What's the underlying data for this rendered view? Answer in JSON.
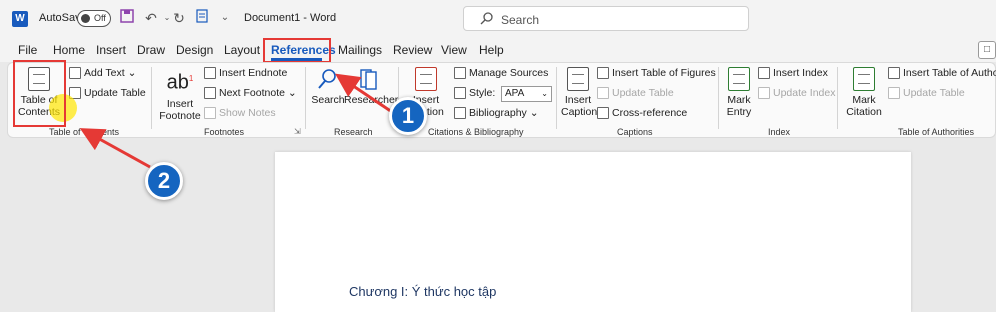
{
  "titlebar": {
    "logo": "W",
    "autosave_label": "AutoSave",
    "autosave_state": "Off",
    "doc_title": "Document1  -  Word",
    "search_placeholder": "Search"
  },
  "tabs": [
    "File",
    "Home",
    "Insert",
    "Draw",
    "Design",
    "Layout",
    "References",
    "Mailings",
    "Review",
    "View",
    "Help"
  ],
  "active_tab": "References",
  "ribbon": {
    "toc": {
      "big_button": [
        "Table of",
        "Contents"
      ],
      "add_text": "Add Text",
      "update_table": "Update Table",
      "group": "Table of Contents"
    },
    "footnotes": {
      "insert_footnote": [
        "Insert",
        "Footnote"
      ],
      "insert_endnote": "Insert Endnote",
      "next_footnote": "Next Footnote",
      "show_notes": "Show Notes",
      "group": "Footnotes"
    },
    "research": {
      "search": "Search",
      "researcher": "Researcher",
      "group": "Research"
    },
    "citations": {
      "insert_citation": [
        "Insert",
        "Citation"
      ],
      "manage_sources": "Manage Sources",
      "style_label": "Style:",
      "style_value": "APA",
      "bibliography": "Bibliography",
      "group": "Citations & Bibliography"
    },
    "captions": {
      "insert_caption": [
        "Insert",
        "Caption"
      ],
      "insert_tof": "Insert Table of Figures",
      "update_table": "Update Table",
      "cross_reference": "Cross-reference",
      "group": "Captions"
    },
    "index": {
      "mark_entry": [
        "Mark",
        "Entry"
      ],
      "insert_index": "Insert Index",
      "update_index": "Update Index",
      "group": "Index"
    },
    "authorities": {
      "mark_citation": [
        "Mark",
        "Citation"
      ],
      "insert_toa": "Insert Table of Authoriti",
      "update_table": "Update Table",
      "group": "Table of Authorities"
    }
  },
  "document": {
    "heading": "Chương I: Ý thức học tập"
  },
  "annotations": {
    "badge1": "1",
    "badge2": "2",
    "color": "#e53935",
    "badge_color": "#1565c0"
  }
}
